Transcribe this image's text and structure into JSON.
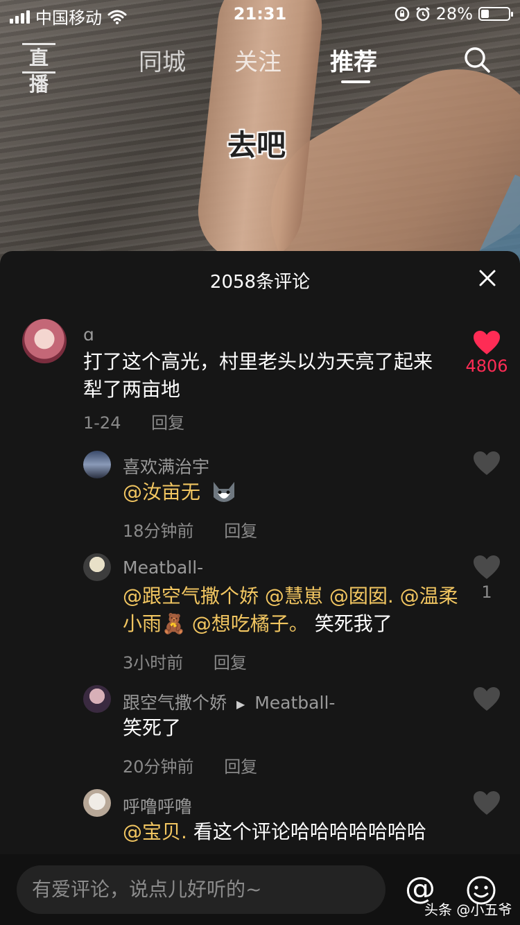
{
  "status_bar": {
    "carrier": "中国移动",
    "time": "21:31",
    "battery": "28%",
    "battery_level": 0.28
  },
  "nav": {
    "live_label": "直播",
    "tabs": [
      "同城",
      "关注",
      "推荐"
    ],
    "active_tab": "推荐"
  },
  "video": {
    "caption": "去吧"
  },
  "comments_panel": {
    "title": "2058条评论",
    "comments": [
      {
        "user": "ɑ",
        "text": "打了这个高光，村里老头以为天亮了起来犁了两亩地",
        "date": "1-24",
        "reply": "回复",
        "likes": "4806",
        "liked": true
      },
      {
        "user": "喜欢满治宇",
        "mention": "@汝亩无",
        "text": "",
        "date": "18分钟前",
        "reply": "回复",
        "likes": ""
      },
      {
        "user": "Meatball-",
        "mentions": [
          "@跟空气撒个娇",
          "@慧崽",
          "@囡囡.",
          "@温柔小雨🧸",
          "@想吃橘子。"
        ],
        "text": "笑死我了",
        "date": "3小时前",
        "reply": "回复",
        "likes": "1"
      },
      {
        "user": "跟空气撒个娇",
        "reply_to": "Meatball-",
        "text": "笑死了",
        "date": "20分钟前",
        "reply": "回复",
        "likes": ""
      },
      {
        "user": "呼噜呼噜",
        "mention": "@宝贝.",
        "text": "看这个评论哈哈哈哈哈哈哈",
        "date": "",
        "reply": "",
        "likes": ""
      }
    ]
  },
  "input": {
    "placeholder": "有爱评论，说点儿好听的~"
  },
  "watermark": "头条 @小五爷",
  "colors": {
    "accent_like": "#fe2c55",
    "mention": "#f2c661",
    "background": "#161616"
  }
}
